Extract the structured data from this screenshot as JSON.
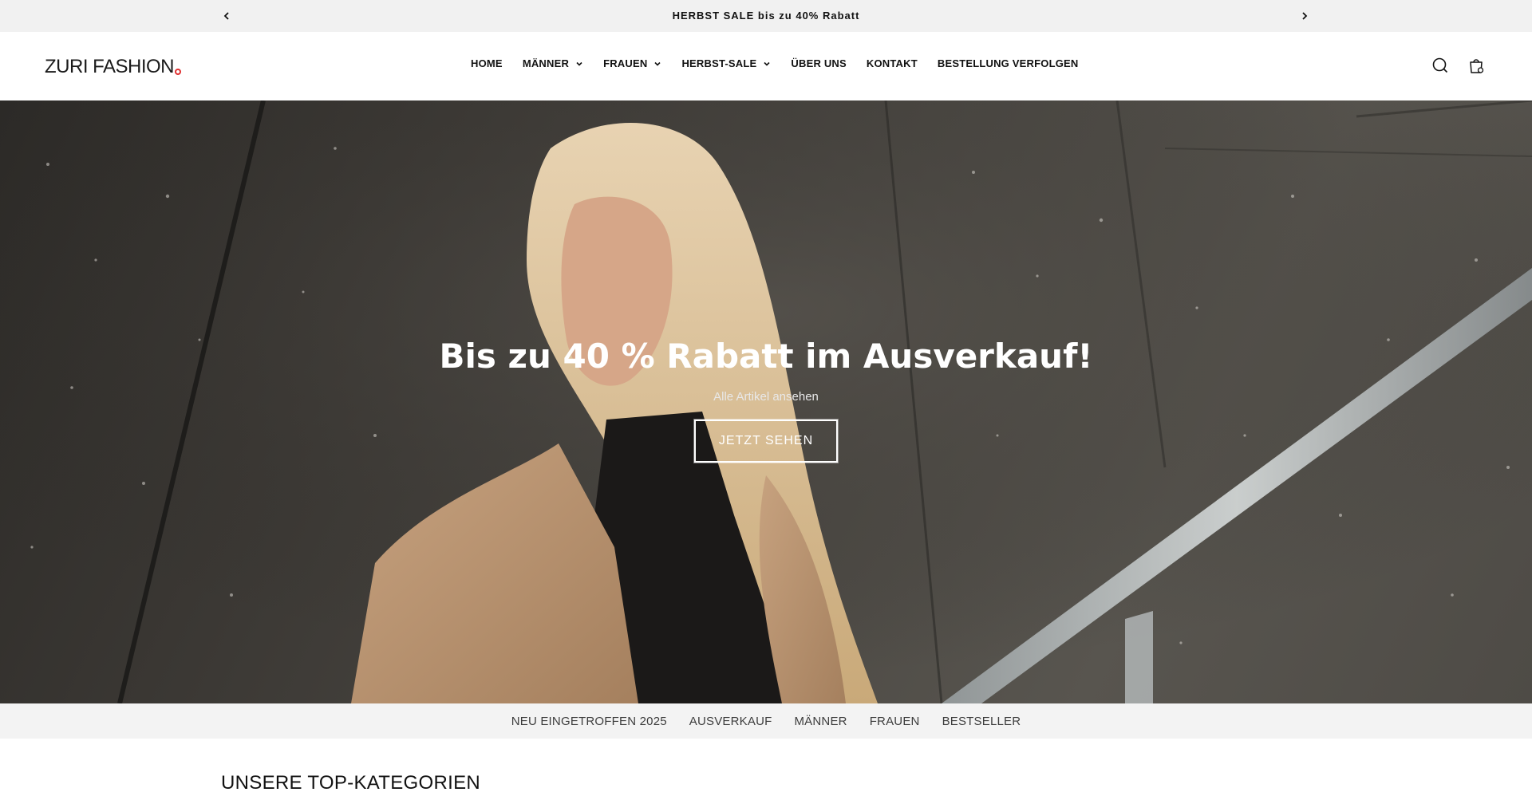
{
  "announcement": {
    "text": "HERBST SALE bis zu 40% Rabatt"
  },
  "header": {
    "logo_text": "ZURI FASHION",
    "nav": [
      {
        "label": "HOME",
        "has_dropdown": false
      },
      {
        "label": "MÄNNER",
        "has_dropdown": true
      },
      {
        "label": "FRAUEN",
        "has_dropdown": true
      },
      {
        "label": "HERBST-SALE",
        "has_dropdown": true
      },
      {
        "label": "ÜBER UNS",
        "has_dropdown": false
      },
      {
        "label": "KONTAKT",
        "has_dropdown": false
      },
      {
        "label": "BESTELLUNG VERFOLGEN",
        "has_dropdown": false
      }
    ],
    "icons": [
      "search-icon",
      "cart-icon"
    ]
  },
  "hero": {
    "title": "Bis zu 40 % Rabatt im Ausverkauf!",
    "subtitle": "Alle Artikel ansehen",
    "button_label": "JETZT SEHEN"
  },
  "category_bar": {
    "links": [
      "NEU EINGETROFFEN 2025",
      "AUSVERKAUF",
      "MÄNNER",
      "FRAUEN",
      "BESTSELLER"
    ]
  },
  "section": {
    "title": "UNSERE TOP-KATEGORIEN"
  },
  "colors": {
    "announcement_bg": "#f1f1f1",
    "logo_accent": "#e03131",
    "category_bar_bg": "#f3f3f3"
  }
}
